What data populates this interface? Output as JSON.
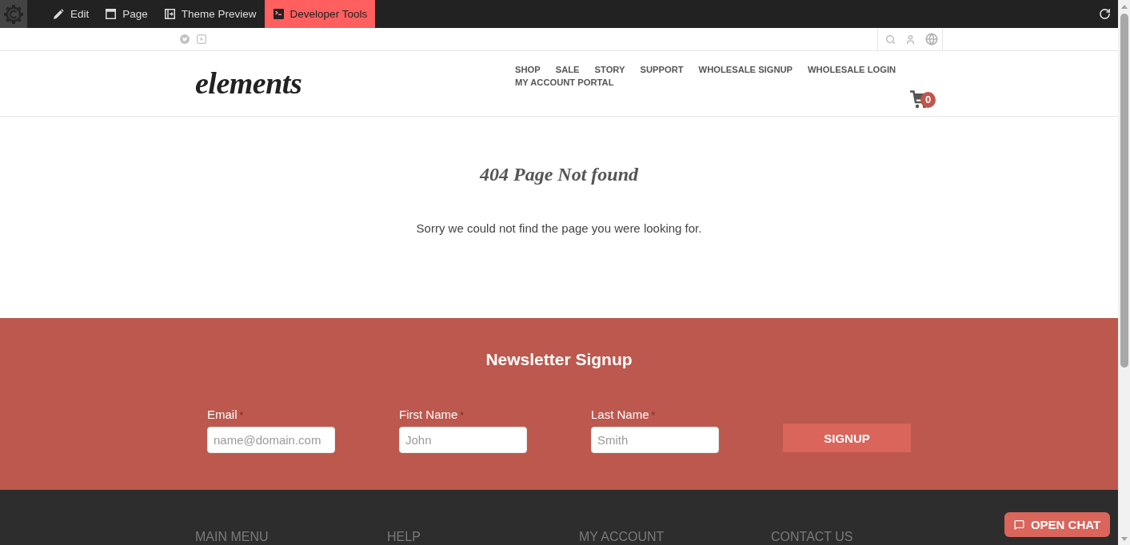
{
  "toolbar": {
    "items": [
      {
        "label": "Edit",
        "selected": false
      },
      {
        "label": "Page",
        "selected": false
      },
      {
        "label": "Theme Preview",
        "selected": false
      },
      {
        "label": "Developer Tools",
        "selected": true
      }
    ]
  },
  "header": {
    "logo": "elements",
    "nav": [
      "SHOP",
      "SALE",
      "STORY",
      "SUPPORT",
      "WHOLESALE SIGNUP",
      "WHOLESALE LOGIN",
      "MY ACCOUNT PORTAL"
    ],
    "cart_count": "0"
  },
  "main": {
    "title": "404 Page Not found",
    "message": "Sorry we could not find the page you were looking for."
  },
  "newsletter": {
    "title": "Newsletter Signup",
    "fields": [
      {
        "label": "Email",
        "required_mark": "*",
        "placeholder": "name@domain.com"
      },
      {
        "label": "First Name",
        "required_mark": "*",
        "placeholder": "John"
      },
      {
        "label": "Last Name",
        "required_mark": "*",
        "placeholder": "Smith"
      }
    ],
    "button": "SIGNUP"
  },
  "footer": {
    "columns": [
      "MAIN MENU",
      "HELP",
      "MY ACCOUNT",
      "CONTACT US"
    ]
  },
  "chat_button": "OPEN CHAT"
}
